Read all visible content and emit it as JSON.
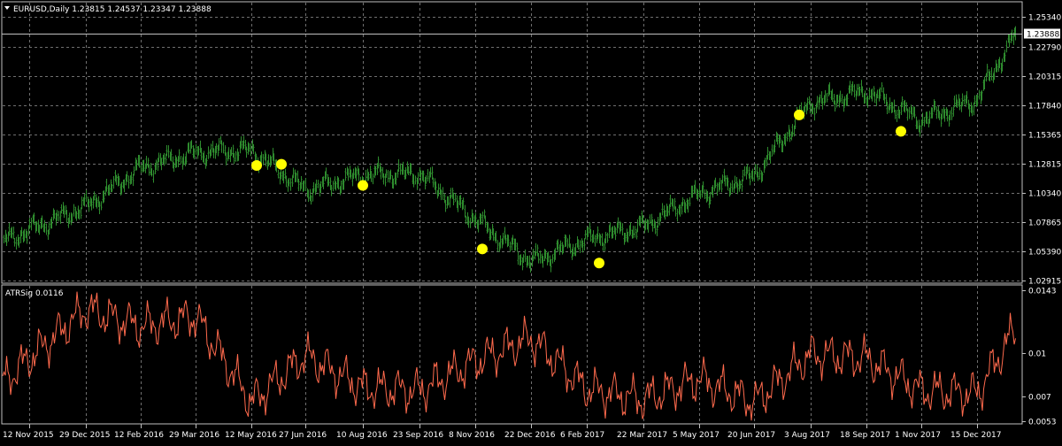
{
  "main_panel": {
    "header": "EURUSD,Daily  1.23815 1.24537 1.23347 1.23888",
    "y_ticks": [
      "1.25340",
      "1.22790",
      "1.20315",
      "1.17840",
      "1.15365",
      "1.12815",
      "1.10340",
      "1.07865",
      "1.05390",
      "1.02915"
    ],
    "current_price": "1.23888",
    "grid": true
  },
  "sub_panel": {
    "header": "ATRSig 0.0116",
    "y_ticks": [
      "0.0143",
      "0.01",
      "0.007",
      "0.0053"
    ]
  },
  "x_ticks": [
    "12 Nov 2015",
    "29 Dec 2015",
    "12 Feb 2016",
    "29 Mar 2016",
    "12 May 2016",
    "27 Jun 2016",
    "10 Aug 2016",
    "23 Sep 2016",
    "8 Nov 2016",
    "22 Dec 2016",
    "6 Feb 2017",
    "22 Mar 2017",
    "5 May 2017",
    "20 Jun 2017",
    "3 Aug 2017",
    "18 Sep 2017",
    "1 Nov 2017",
    "15 Dec 2017"
  ],
  "colors": {
    "background": "#000000",
    "bars": "#2e8b2e",
    "signal_dots": "#ffff00",
    "indicator_line": "#ff6a4d",
    "grid": "#6f6f6f",
    "frame": "#c0c0c0"
  },
  "chart_data": [
    {
      "type": "line",
      "series": [
        {
          "name": "EURUSD",
          "x": [
            "12 Nov 2015",
            "29 Dec 2015",
            "12 Feb 2016",
            "29 Mar 2016",
            "12 May 2016",
            "27 Jun 2016",
            "10 Aug 2016",
            "23 Sep 2016",
            "8 Nov 2016",
            "22 Dec 2016",
            "6 Feb 2017",
            "22 Mar 2017",
            "5 May 2017",
            "20 Jun 2017",
            "3 Aug 2017",
            "18 Sep 2017",
            "1 Nov 2017",
            "15 Dec 2017"
          ],
          "values": [
            1.072,
            1.092,
            1.125,
            1.138,
            1.14,
            1.106,
            1.119,
            1.12,
            1.081,
            1.045,
            1.064,
            1.075,
            1.103,
            1.118,
            1.18,
            1.19,
            1.165,
            1.183
          ]
        }
      ],
      "signals": [
        {
          "x": "12 May 2016",
          "y": 1.127
        },
        {
          "x": "27 Jun 2016",
          "y": 1.128
        },
        {
          "x": "10 Aug 2016",
          "y": 1.11
        },
        {
          "x": "8 Nov 2016",
          "y": 1.056
        },
        {
          "x": "6 Feb 2017",
          "y": 1.044
        },
        {
          "x": "3 Aug 2017",
          "y": 1.17
        },
        {
          "x": "1 Nov 2017",
          "y": 1.156
        }
      ],
      "last": {
        "x": "15 Dec 2017",
        "open": 1.23815,
        "high": 1.24537,
        "low": 1.23347,
        "close": 1.23888
      },
      "ylim": [
        1.02915,
        1.2534
      ],
      "grid": true
    },
    {
      "type": "line",
      "series": [
        {
          "name": "ATRSig",
          "x": [
            "12 Nov 2015",
            "29 Dec 2015",
            "12 Feb 2016",
            "29 Mar 2016",
            "12 May 2016",
            "27 Jun 2016",
            "10 Aug 2016",
            "23 Sep 2016",
            "8 Nov 2016",
            "22 Dec 2016",
            "6 Feb 2017",
            "22 Mar 2017",
            "5 May 2017",
            "20 Jun 2017",
            "3 Aug 2017",
            "18 Sep 2017",
            "1 Nov 2017",
            "15 Dec 2017"
          ],
          "values": [
            0.0096,
            0.013,
            0.0118,
            0.0125,
            0.0066,
            0.0098,
            0.0076,
            0.0074,
            0.0094,
            0.011,
            0.0075,
            0.0068,
            0.0082,
            0.0066,
            0.0099,
            0.0096,
            0.0074,
            0.0072
          ]
        }
      ],
      "last_value": 0.0116,
      "ylim": [
        0.0053,
        0.0143
      ]
    }
  ]
}
